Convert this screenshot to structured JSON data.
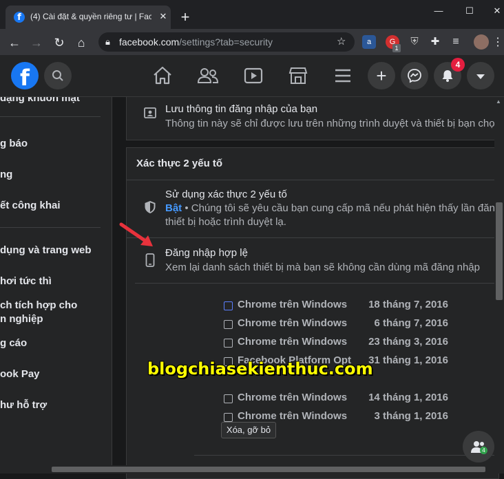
{
  "browser": {
    "tab_title": "(4) Cài đặt & quyền riêng tư | Fac",
    "tab_close": "✕",
    "new_tab": "+",
    "window_controls": {
      "minimize": "—",
      "maximize": "☐",
      "close": "✕"
    },
    "url_host": "facebook.com",
    "url_path": "/settings?tab=security",
    "extensions": [
      "amazon-icon",
      "grammarly-icon",
      "shield-ext-icon",
      "puzzle-icon",
      "profile-avatar"
    ],
    "extension_badge": "1"
  },
  "header": {
    "logo": "f",
    "nav_icons": [
      "home-icon",
      "friends-icon",
      "watch-icon",
      "marketplace-icon",
      "menu-icon"
    ],
    "actions": {
      "create": "+",
      "notifications_count": "4"
    }
  },
  "sidebar": {
    "items": [
      "dạng khuôn mặt",
      "g báo",
      "ng",
      "ết công khai",
      "dụng và trang web",
      "hơi tức thì",
      "ch tích hợp cho",
      "n nghiệp",
      "g cáo",
      "ook Pay",
      "hư hỗ trợ"
    ]
  },
  "main": {
    "save_login": {
      "title": "Lưu thông tin đăng nhập của bạn",
      "subtitle": "Thông tin này sẽ chỉ được lưu trên những trình duyệt và thiết bị bạn chọ"
    },
    "two_factor": {
      "section_title": "Xác thực 2 yếu tố",
      "use_2fa_title": "Sử dụng xác thực 2 yếu tố",
      "use_2fa_status": "Bật",
      "use_2fa_sub1": " • Chúng tôi sẽ yêu cầu bạn cung cấp mã nếu phát hiện thấy lần đăn",
      "use_2fa_sub2": "thiết bị hoặc trình duyệt lạ.",
      "authorized_title": "Đăng nhập hợp lệ",
      "authorized_sub": "Xem lại danh sách thiết bị mà bạn sẽ không cần dùng mã đăng nhập"
    },
    "devices": [
      {
        "name": "Chrome trên Windows",
        "date": "18 tháng 7, 2016"
      },
      {
        "name": "Chrome trên Windows",
        "date": "6 tháng 7, 2016"
      },
      {
        "name": "Chrome trên Windows",
        "date": "23 tháng 3, 2016"
      },
      {
        "name": "Facebook Platform Opt",
        "date": "31 tháng 1, 2016"
      },
      {
        "name": "Chrome trên Windows",
        "date": "14 tháng 1, 2016"
      },
      {
        "name": "Chrome trên Windows",
        "date": "3 tháng 1, 2016"
      }
    ],
    "remove_button": "Xóa, gỡ bỏ"
  },
  "watermark": "blogchiasekienthuc.com",
  "chat_fab": {
    "badge": "4"
  },
  "colors": {
    "accent": "#1877f2",
    "status_on": "#4599ff",
    "badge": "#e41e3f",
    "arrow": "#e8323c"
  }
}
